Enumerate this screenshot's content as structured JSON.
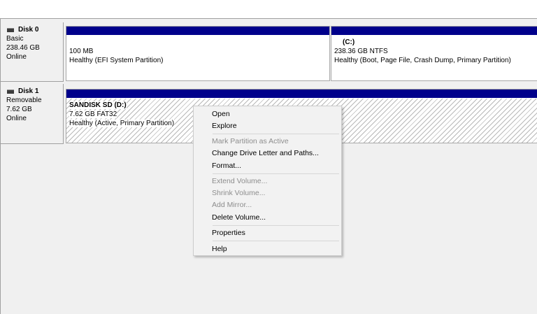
{
  "disks": [
    {
      "name": "Disk 0",
      "type": "Basic",
      "size": "238.46 GB",
      "status": "Online",
      "partitions": [
        {
          "title": "",
          "line1": "100 MB",
          "line2": "Healthy (EFI System Partition)"
        },
        {
          "title": "(C:)",
          "line1": "238.36 GB NTFS",
          "line2": "Healthy (Boot, Page File, Crash Dump, Primary Partition)"
        }
      ]
    },
    {
      "name": "Disk 1",
      "type": "Removable",
      "size": "7.62 GB",
      "status": "Online",
      "partitions": [
        {
          "title": "SANDISK SD  (D:)",
          "line1": "7.62 GB FAT32",
          "line2": "Healthy (Active, Primary Partition)"
        }
      ]
    }
  ],
  "context_menu": {
    "open": "Open",
    "explore": "Explore",
    "mark_active": "Mark Partition as Active",
    "change_letter": "Change Drive Letter and Paths...",
    "format": "Format...",
    "extend": "Extend Volume...",
    "shrink": "Shrink Volume...",
    "add_mirror": "Add Mirror...",
    "delete": "Delete Volume...",
    "properties": "Properties",
    "help": "Help"
  },
  "colors": {
    "partition_header": "#00008b",
    "disabled_text": "#8d8d8d"
  },
  "icons": {
    "disk": "disk-drive-icon"
  }
}
